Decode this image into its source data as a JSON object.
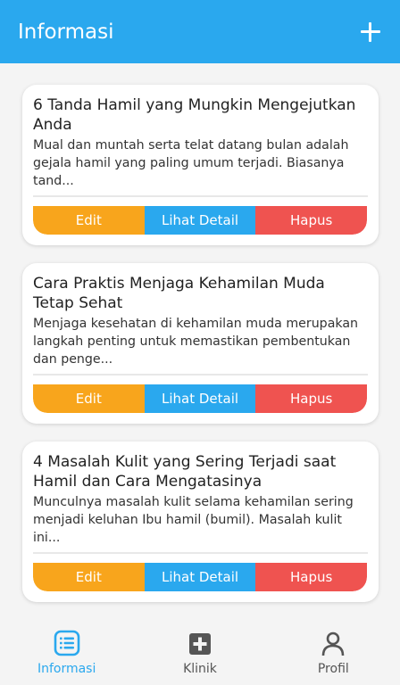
{
  "appbar": {
    "title": "Informasi",
    "add_icon": "plus-icon"
  },
  "articles": [
    {
      "title": "6 Tanda Hamil yang Mungkin Mengejutkan Anda",
      "excerpt": "Mual dan muntah serta telat datang bulan adalah gejala hamil yang paling umum terjadi. Biasanya tand..."
    },
    {
      "title": "Cara Praktis Menjaga Kehamilan Muda Tetap Sehat",
      "excerpt": "Menjaga kesehatan di kehamilan muda merupakan langkah penting untuk memastikan pembentukan dan penge..."
    },
    {
      "title": "4 Masalah Kulit yang Sering Terjadi saat Hamil dan Cara Mengatasinya",
      "excerpt": "Munculnya masalah kulit selama kehamilan sering menjadi keluhan Ibu hamil (bumil). Masalah kulit ini..."
    }
  ],
  "actions": {
    "edit": "Edit",
    "detail": "Lihat Detail",
    "delete": "Hapus"
  },
  "colors": {
    "primary": "#2aa8ee",
    "edit": "#f8a51c",
    "delete": "#ef5350"
  },
  "bottom_nav": [
    {
      "label": "Informasi",
      "icon": "list-icon",
      "active": true
    },
    {
      "label": "Klinik",
      "icon": "medical-cross-icon",
      "active": false
    },
    {
      "label": "Profil",
      "icon": "user-icon",
      "active": false
    }
  ]
}
